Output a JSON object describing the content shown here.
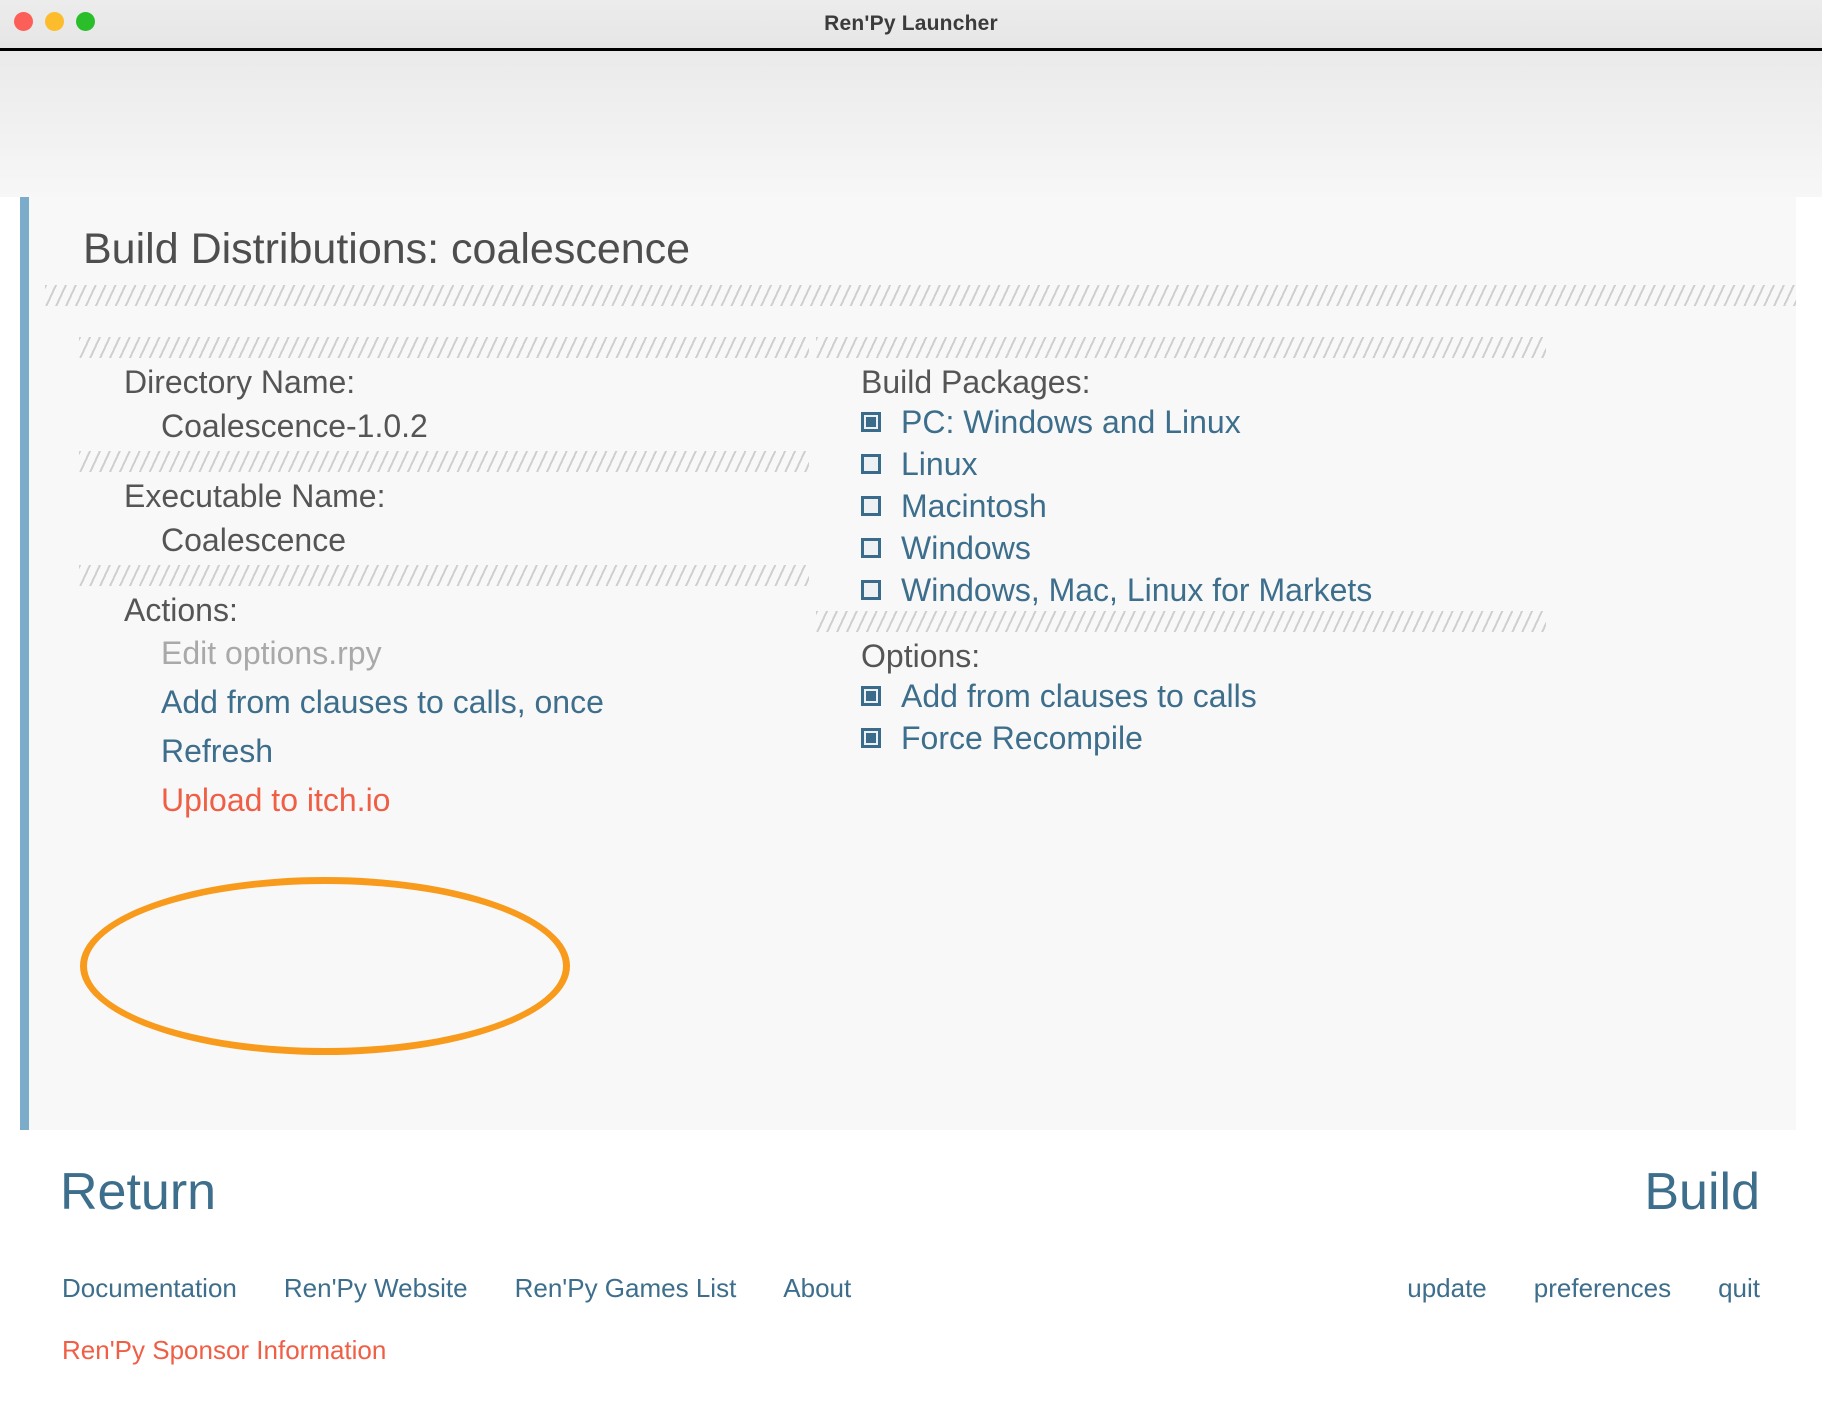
{
  "window": {
    "title": "Ren'Py Launcher",
    "traffic_lights": [
      "close-button",
      "minimize-button",
      "maximize-button"
    ]
  },
  "page": {
    "title": "Build Distributions: coalescence"
  },
  "left_column": {
    "directory": {
      "label": "Directory Name:",
      "value": "Coalescence-1.0.2"
    },
    "executable": {
      "label": "Executable Name:",
      "value": "Coalescence"
    },
    "actions": {
      "label": "Actions:",
      "items": [
        {
          "label": "Edit options.rpy",
          "state": "disabled"
        },
        {
          "label": "Add from clauses to calls, once",
          "state": "link"
        },
        {
          "label": "Refresh",
          "state": "link"
        },
        {
          "label": "Upload to itch.io",
          "state": "alert"
        }
      ]
    }
  },
  "right_column": {
    "packages": {
      "label": "Build Packages:",
      "items": [
        {
          "label": "PC: Windows and Linux",
          "checked": true
        },
        {
          "label": "Linux",
          "checked": false
        },
        {
          "label": "Macintosh",
          "checked": false
        },
        {
          "label": "Windows",
          "checked": false
        },
        {
          "label": "Windows, Mac, Linux for Markets",
          "checked": false
        }
      ]
    },
    "options": {
      "label": "Options:",
      "items": [
        {
          "label": "Add from clauses to calls",
          "checked": true
        },
        {
          "label": "Force Recompile",
          "checked": true
        }
      ]
    }
  },
  "buttons": {
    "return": "Return",
    "build": "Build"
  },
  "footer": {
    "links": [
      "Documentation",
      "Ren'Py Website",
      "Ren'Py Games List",
      "About"
    ],
    "sponsor": "Ren'Py Sponsor Information",
    "right_links": [
      "update",
      "preferences",
      "quit"
    ]
  },
  "annotation": {
    "type": "ellipse-highlight",
    "color": "#f89b1c",
    "target": "Upload to itch.io"
  },
  "colors": {
    "accent_bar": "#7bacc9",
    "link": "#3d6e8c",
    "alert": "#ef5e45",
    "disabled": "#a9a9a9",
    "label": "#555555",
    "checkbox": "#3a6b8a",
    "annotation": "#f89b1c"
  }
}
